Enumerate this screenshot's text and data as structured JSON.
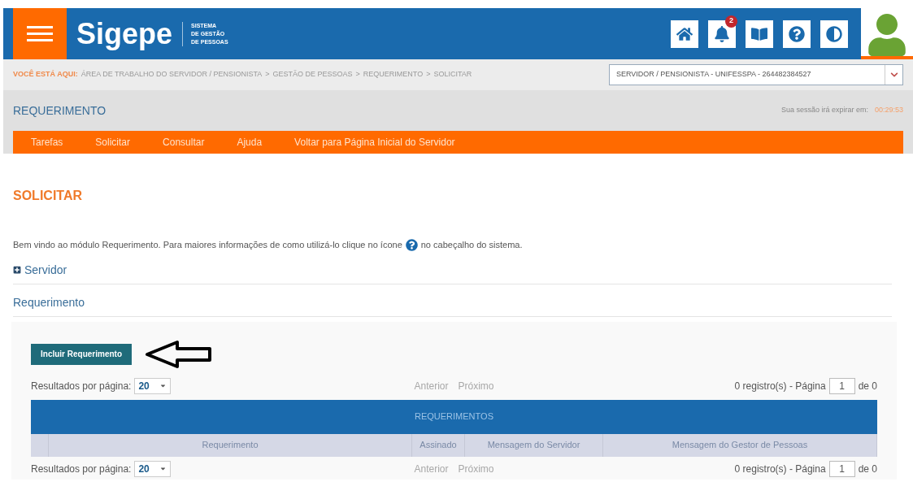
{
  "header": {
    "logo": "Sigepe",
    "subtitle": [
      "SISTEMA",
      "DE GESTÃO",
      "DE PESSOAS"
    ],
    "notification_count": "2"
  },
  "breadcrumb": {
    "label": "VOCÊ ESTÁ AQUI:",
    "items": [
      "ÁREA DE TRABALHO DO SERVIDOR / PENSIONISTA",
      "GESTÃO DE PESSOAS",
      "REQUERIMENTO",
      "SOLICITAR"
    ],
    "separator": ">"
  },
  "profile_select": {
    "value": "SERVIDOR / PENSIONISTA - UNIFESSPA - 264482384527"
  },
  "module": {
    "title": "REQUERIMENTO",
    "session_label": "Sua sessão irá expirar em:",
    "session_time": "00:29:53"
  },
  "menu": [
    {
      "label": "Tarefas"
    },
    {
      "label": "Solicitar"
    },
    {
      "label": "Consultar"
    },
    {
      "label": "Ajuda"
    },
    {
      "label": "Voltar para Página Inicial do Servidor"
    }
  ],
  "page_title": "SOLICITAR",
  "welcome": {
    "before": "Bem vindo ao módulo Requerimento. Para maiores informações de como utilizá-lo clique no ícone",
    "after": "no cabeçalho do sistema."
  },
  "sections": [
    {
      "label": "Servidor",
      "expanded": false
    },
    {
      "label": "Requerimento",
      "expanded": true
    }
  ],
  "add_button": "Incluir Requerimento",
  "paginations": [
    {
      "label": "Resultados por página:",
      "page_size": "20",
      "prev": {
        "label": "Anterior",
        "disabled": true
      },
      "next": {
        "label": "Próximo",
        "disabled": true
      },
      "count": "0 registro(s) - Página",
      "page": "1",
      "of": "de 0"
    },
    {
      "label": "Resultados por página:",
      "page_size": "20",
      "prev": {
        "label": "Anterior",
        "disabled": true
      },
      "next": {
        "label": "Próximo",
        "disabled": true
      },
      "count": "0 registro(s) - Página",
      "page": "1",
      "of": "de 0"
    }
  ],
  "table": {
    "title": "REQUERIMENTOS",
    "columns": [
      "Requerimento",
      "Assinado",
      "Mensagem do Servidor",
      "Mensagem do Gestor de Pessoas"
    ]
  }
}
